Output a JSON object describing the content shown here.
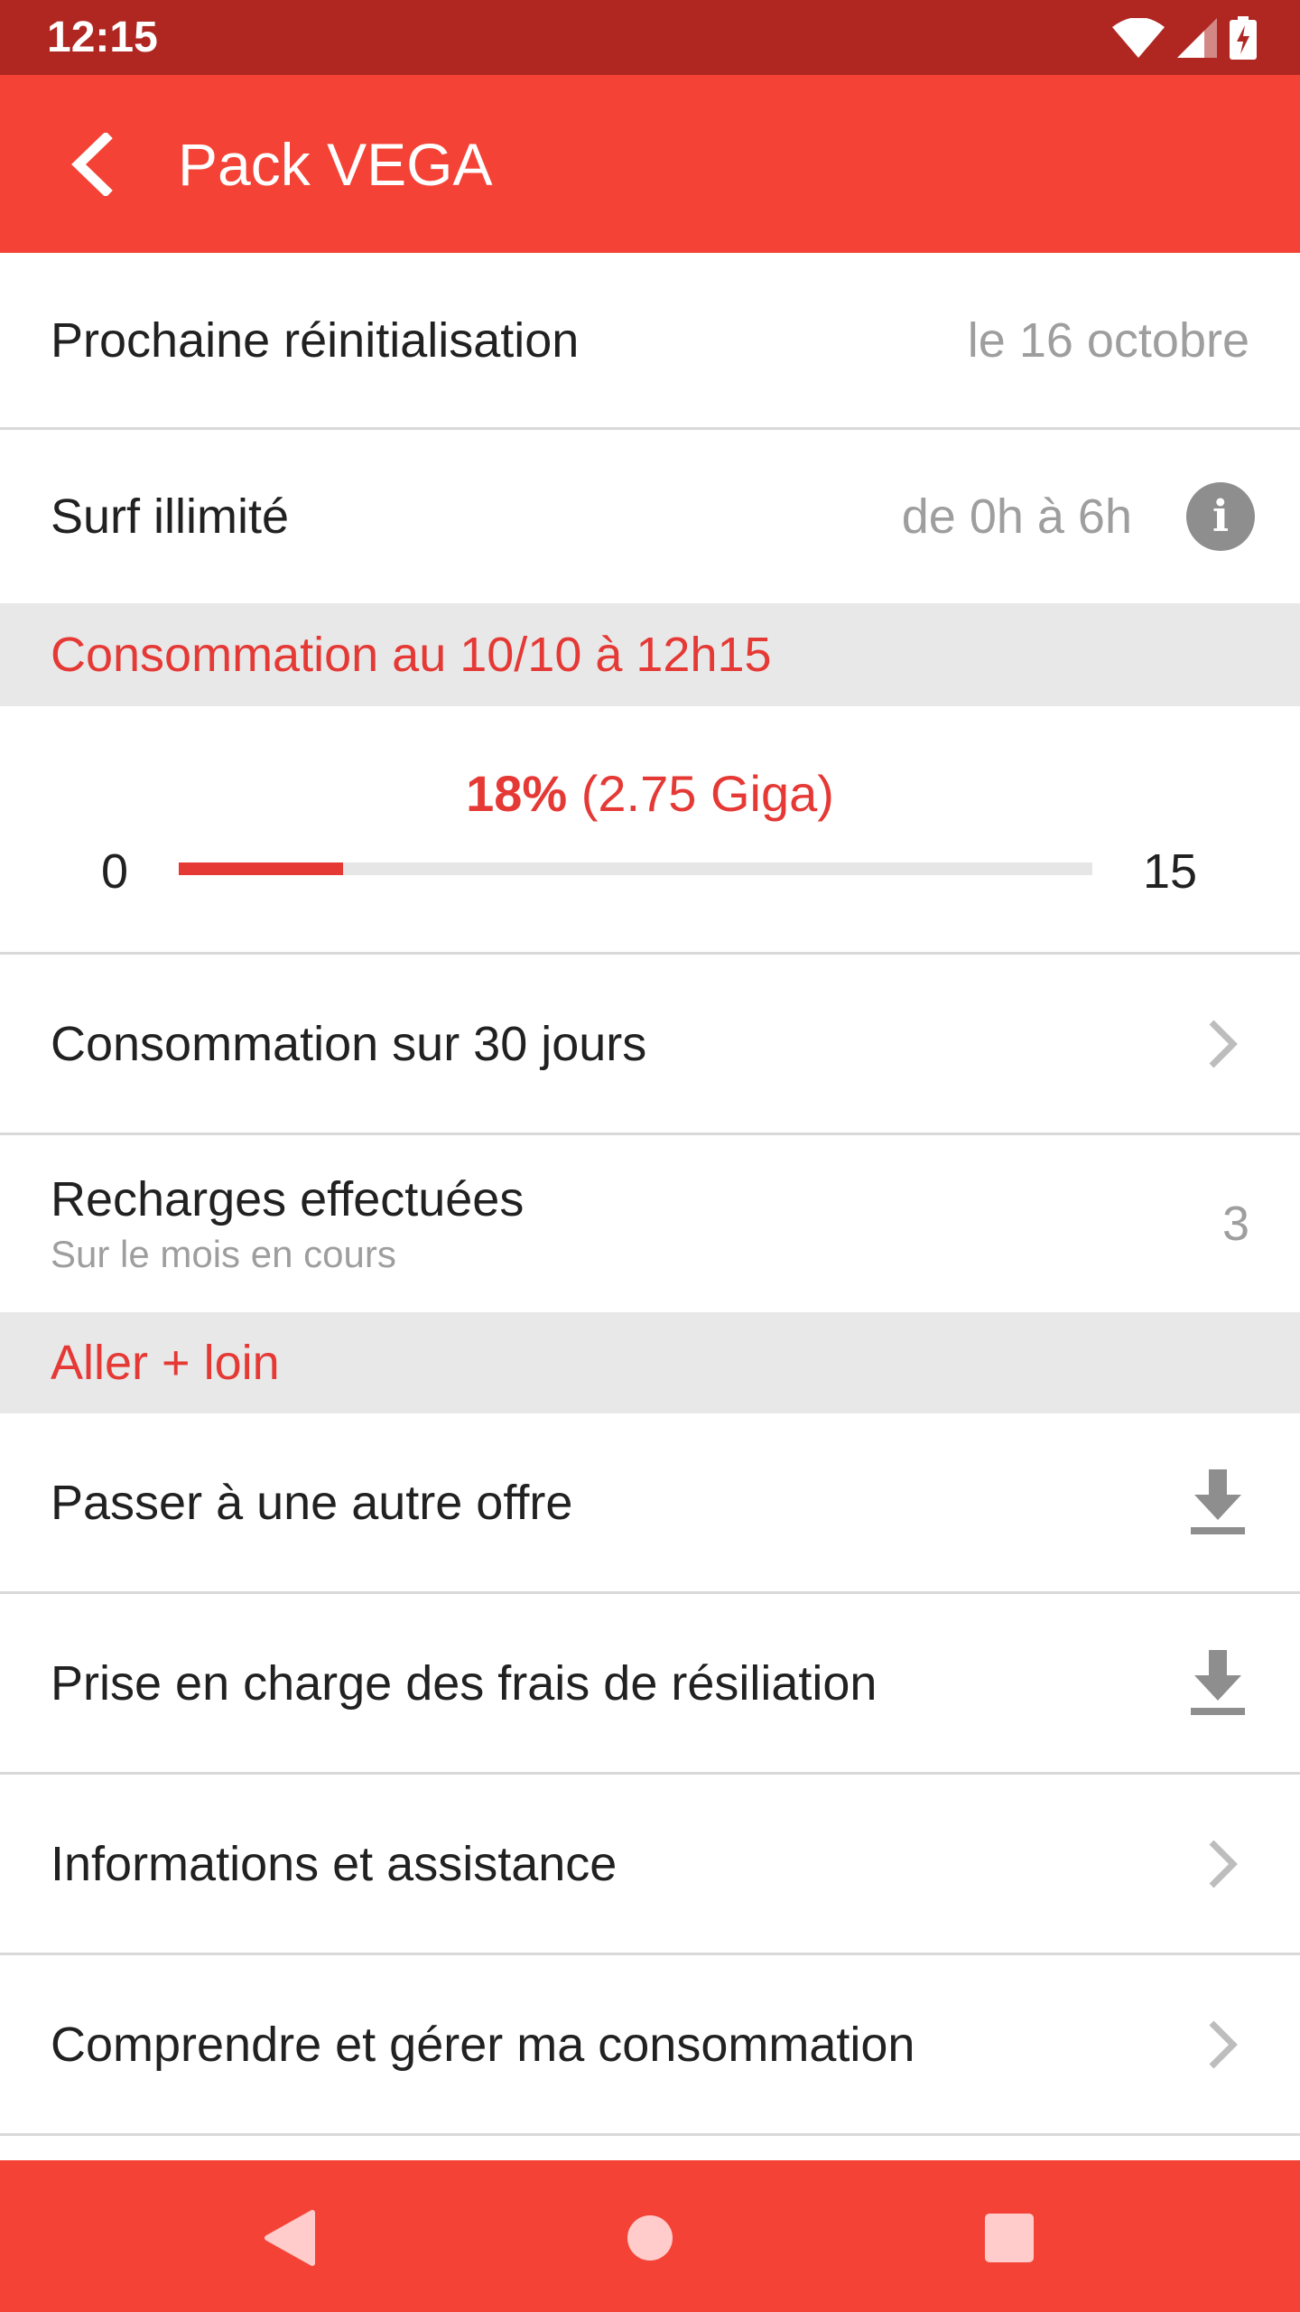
{
  "status_bar": {
    "time": "12:15"
  },
  "app_bar": {
    "title": "Pack VEGA"
  },
  "reset": {
    "label": "Prochaine réinitialisation",
    "value": "le 16 octobre"
  },
  "unlimited": {
    "label": "Surf illimité",
    "value": "de 0h à 6h"
  },
  "consumption_header": "Consommation au 10/10 à 12h15",
  "usage": {
    "percent_label": "18%",
    "amount_label": "(2.75 Giga)",
    "min": "0",
    "max": "15",
    "fraction": 0.18
  },
  "consumption_30": {
    "label": "Consommation sur 30 jours"
  },
  "recharges": {
    "label": "Recharges effectuées",
    "sublabel": "Sur le mois en cours",
    "value": "3"
  },
  "more_header": "Aller + loin",
  "menu": [
    {
      "label": "Passer à une autre offre",
      "icon": "download-icon"
    },
    {
      "label": "Prise en charge des frais de résiliation",
      "icon": "download-icon"
    },
    {
      "label": "Informations et assistance",
      "icon": "chevron-right-icon"
    },
    {
      "label": "Comprendre et gérer ma consommation",
      "icon": "chevron-right-icon"
    }
  ],
  "colors": {
    "accent": "#f44336",
    "status": "#b02722",
    "text_red": "#e53935"
  }
}
